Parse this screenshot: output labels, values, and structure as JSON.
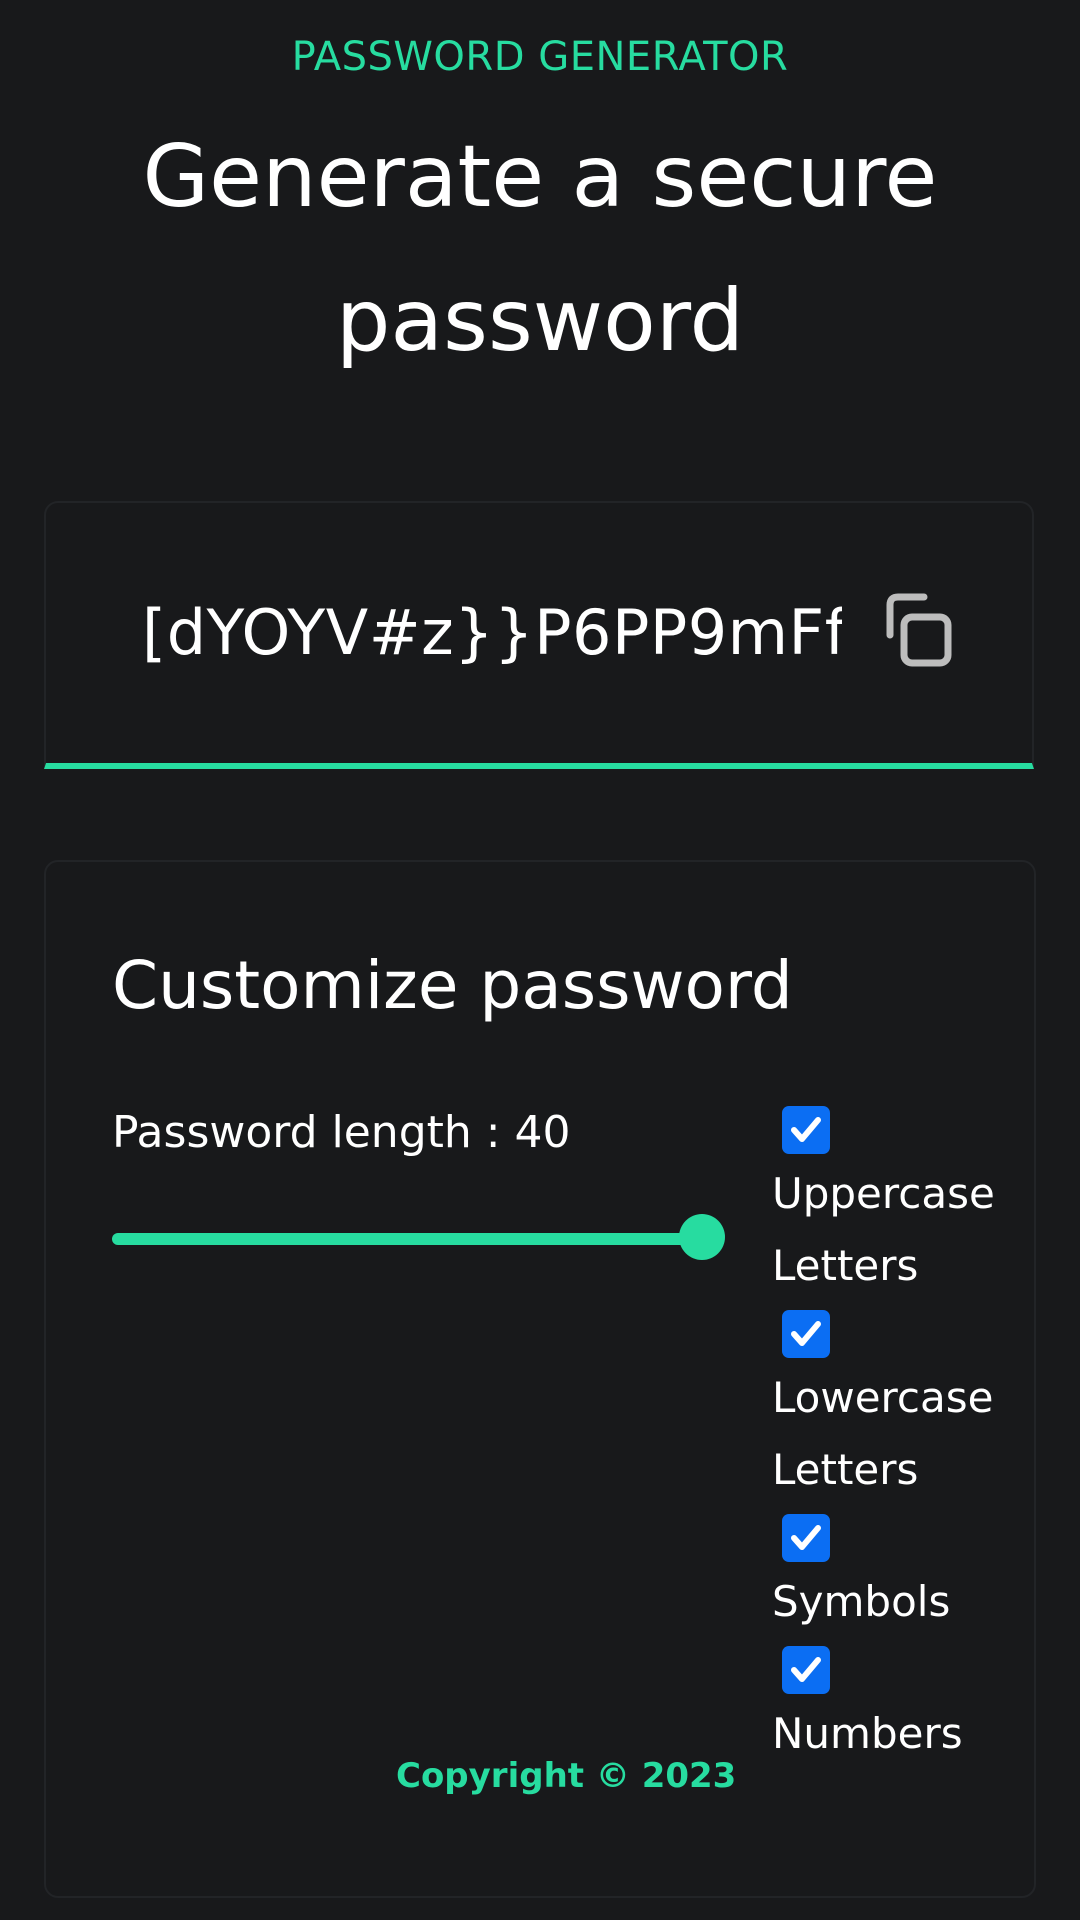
{
  "header": {
    "eyebrow": "PASSWORD GENERATOR",
    "headline_line1": "Generate a secure",
    "headline_line2": "password"
  },
  "password": {
    "value": "[dYOYV#z}}P6PP9mFf",
    "copy_icon": "copy-icon"
  },
  "settings": {
    "title": "Customize password",
    "length_label": "Password length : 40",
    "length_value": 40,
    "length_fraction": 1.0,
    "options": [
      {
        "label": "Uppercase Letters",
        "checked": true
      },
      {
        "label": "Lowercase Letters",
        "checked": true
      },
      {
        "label": "Symbols",
        "checked": true
      },
      {
        "label": "Numbers",
        "checked": true
      }
    ]
  },
  "footer": {
    "copyright": "Copyright © 2023"
  },
  "colors": {
    "background": "#18191b",
    "accent": "#27dca0",
    "checkbox": "#0b6ef3",
    "text": "#ffffff"
  }
}
